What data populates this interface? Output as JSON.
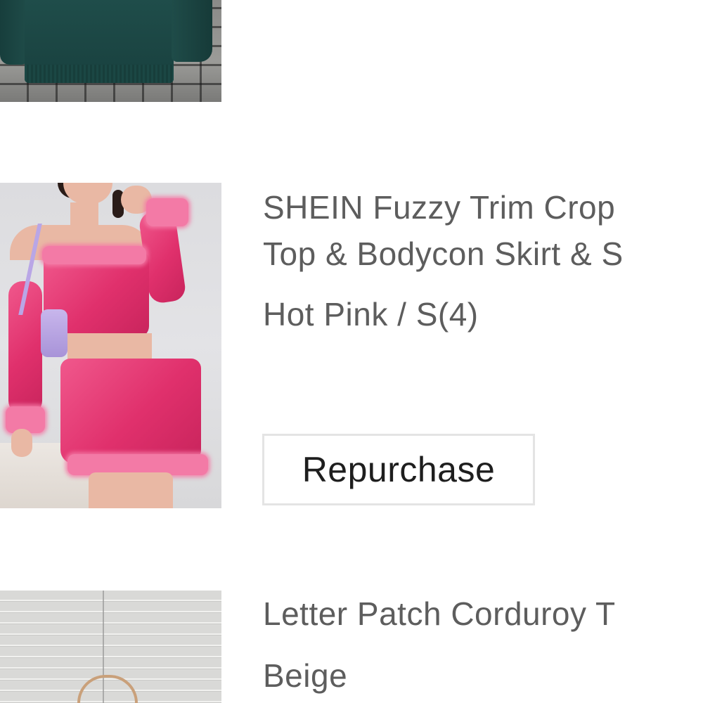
{
  "orders": [
    {
      "title_line1": "",
      "title_line2": "",
      "variant": "",
      "image_icon": "green-sweater-image"
    },
    {
      "title_line1": "SHEIN Fuzzy Trim Crop",
      "title_line2": "Top & Bodycon Skirt & S",
      "variant": "Hot Pink / S(4)",
      "image_icon": "pink-outfit-image",
      "action_label": "Repurchase"
    },
    {
      "title_line1": "Letter Patch Corduroy T",
      "variant": "Beige",
      "image_icon": "beige-top-image"
    }
  ],
  "colors": {
    "text_secondary": "#5d5d5d",
    "text_primary": "#1e1e1e",
    "button_border": "#e4e4e4",
    "background": "#ffffff",
    "accent_pink": "#e0306c",
    "sweater_green": "#1f4d4a"
  }
}
